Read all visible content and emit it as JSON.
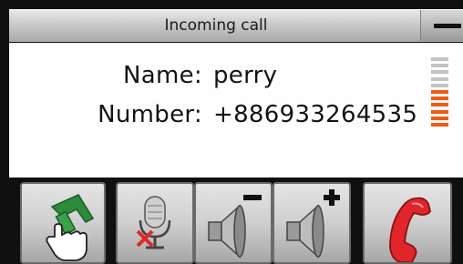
{
  "window": {
    "title": "Incoming call"
  },
  "caller": {
    "name_label": "Name:",
    "name_value": "perry",
    "number_label": "Number:",
    "number_value": "+886933264535"
  },
  "signal": {
    "level": 0.55,
    "active_color": "#f05a13",
    "inactive_color": "#c2c2c2"
  },
  "buttons": [
    {
      "name": "answer-button",
      "icon": "hand-answer-icon"
    },
    {
      "name": "mute-mic-button",
      "icon": "microphone-mute-icon"
    },
    {
      "name": "volume-down-button",
      "icon": "speaker-minus-icon"
    },
    {
      "name": "volume-up-button",
      "icon": "speaker-plus-icon"
    },
    {
      "name": "hang-up-button",
      "icon": "red-phone-handset-icon"
    }
  ],
  "colors": {
    "accent_orange": "#f05a13",
    "answer_green": "#2f8a3c",
    "hangup_red": "#e0262b"
  }
}
